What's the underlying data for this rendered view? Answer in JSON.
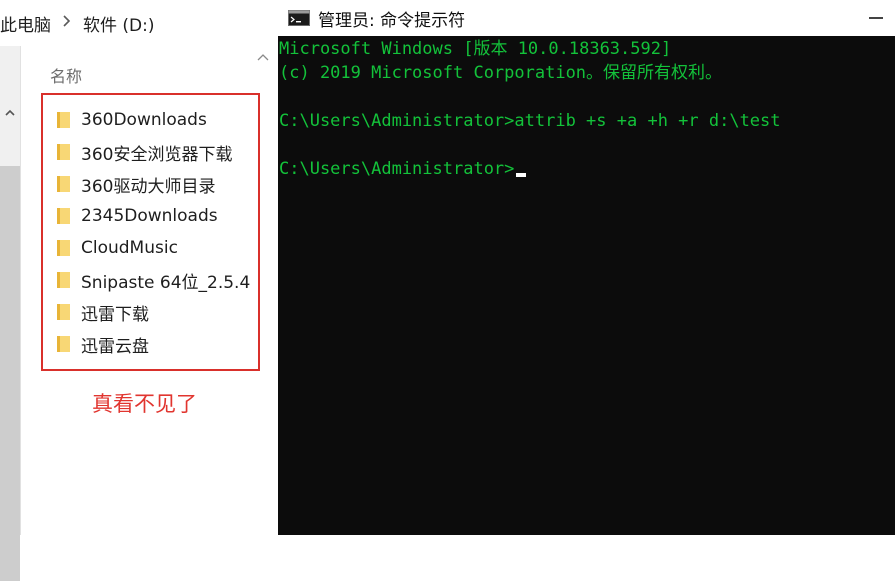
{
  "explorer": {
    "breadcrumb": [
      "此电脑",
      "软件 (D:)"
    ],
    "column_header": "名称",
    "folders": [
      "360Downloads",
      "360安全浏览器下载",
      "360驱动大师目录",
      "2345Downloads",
      "CloudMusic",
      "Snipaste 64位_2.5.4",
      "迅雷下载",
      "迅雷云盘"
    ],
    "annotation": "真看不见了",
    "highlight_color": "#d9302b",
    "folder_icon": "folder-icon"
  },
  "cmd": {
    "title": "管理员: 命令提示符",
    "icon": "cmd-icon",
    "lines": [
      "Microsoft Windows [版本 10.0.18363.592]",
      "(c) 2019 Microsoft Corporation。保留所有权利。",
      "",
      "C:\\Users\\Administrator>attrib +s +a +h +r d:\\test",
      "",
      "C:\\Users\\Administrator>"
    ],
    "text_color": "#13c23a",
    "background": "#0c0c0c"
  }
}
